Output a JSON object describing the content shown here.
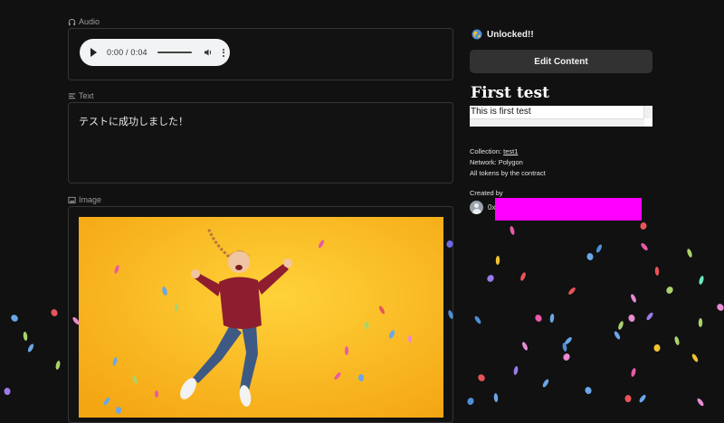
{
  "audio": {
    "label": "Audio",
    "time": "0:00 / 0:04",
    "icon": "headphones-icon"
  },
  "text": {
    "label": "Text",
    "content": "テストに成功しました！",
    "icon": "text-lines-icon"
  },
  "image": {
    "label": "Image",
    "icon": "image-icon",
    "alt": "Girl in red sweater jumping on yellow background"
  },
  "status": {
    "text": "Unlocked!!",
    "icon": "globe-icon"
  },
  "edit_button": "Edit Content",
  "title": "First test",
  "description": "This is first test",
  "details": {
    "collection_label": "Collection:",
    "collection_value": "test1",
    "network_label": "Network:",
    "network_value": "Polygon",
    "all_tokens": "All tokens by the contract"
  },
  "creator": {
    "label": "Created by",
    "address_prefix": "0x"
  },
  "colors": {
    "background": "#111111",
    "panel_border": "#343434",
    "button": "#323232",
    "redaction": "#ff00ff",
    "image_bg": "#f7b41a",
    "sweater": "#8d1d2f",
    "jeans": "#3e5a84"
  }
}
